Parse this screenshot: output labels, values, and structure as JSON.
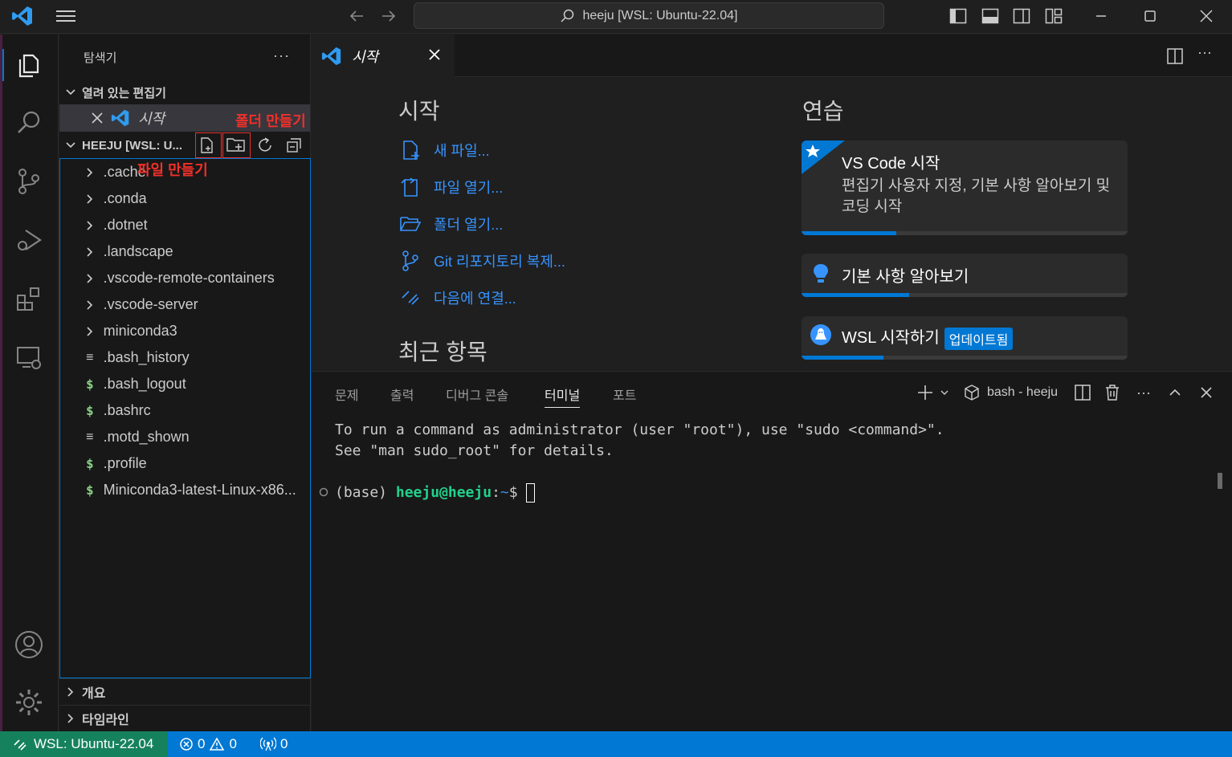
{
  "window": {
    "command_center_text": "heeju [WSL: Ubuntu-22.04]"
  },
  "sidebar": {
    "title": "탐색기",
    "open_editors_header": "열려 있는 편집기",
    "open_editors": [
      {
        "label": "시작"
      }
    ],
    "folder_header": "HEEJU [WSL: U...",
    "tree": [
      {
        "label": ".cache",
        "kind": "folder"
      },
      {
        "label": ".conda",
        "kind": "folder"
      },
      {
        "label": ".dotnet",
        "kind": "folder"
      },
      {
        "label": ".landscape",
        "kind": "folder"
      },
      {
        "label": ".vscode-remote-containers",
        "kind": "folder"
      },
      {
        "label": ".vscode-server",
        "kind": "folder"
      },
      {
        "label": "miniconda3",
        "kind": "folder"
      },
      {
        "label": ".bash_history",
        "kind": "text"
      },
      {
        "label": ".bash_logout",
        "kind": "shell"
      },
      {
        "label": ".bashrc",
        "kind": "shell"
      },
      {
        "label": ".motd_shown",
        "kind": "text"
      },
      {
        "label": ".profile",
        "kind": "shell"
      },
      {
        "label": "Miniconda3-latest-Linux-x86...",
        "kind": "shell"
      }
    ],
    "outline_label": "개요",
    "timeline_label": "타임라인"
  },
  "annotations": {
    "new_folder": "폴더 만들기",
    "new_file": "파일 만들기"
  },
  "editor": {
    "tab_label": "시작",
    "welcome": {
      "start_heading": "시작",
      "start_items": [
        {
          "label": "새 파일...",
          "icon": "new-file-icon"
        },
        {
          "label": "파일 열기...",
          "icon": "open-file-icon"
        },
        {
          "label": "폴더 열기...",
          "icon": "open-folder-icon"
        },
        {
          "label": "Git 리포지토리 복제...",
          "icon": "git-branch-icon"
        },
        {
          "label": "다음에 연결...",
          "icon": "remote-icon"
        }
      ],
      "recent_heading": "최근 항목",
      "walkthroughs_heading": "연습",
      "walkthroughs": [
        {
          "title": "VS Code 시작",
          "description": "편집기 사용자 지정, 기본 사항 알아보기 및 코딩 시작",
          "progress": 0.29
        },
        {
          "title": "기본 사항 알아보기",
          "progress": 0.33
        },
        {
          "title": "WSL 시작하기",
          "badge": "업데이트됨",
          "progress": 0.25
        }
      ]
    }
  },
  "panel": {
    "tabs": [
      "문제",
      "출력",
      "디버그 콘솔",
      "터미널",
      "포트"
    ],
    "active_tab": "터미널",
    "terminal_name": "bash - heeju",
    "terminal": {
      "line1": "To run a command as administrator (user \"root\"), use \"sudo <command>\".",
      "line2": "See \"man sudo_root\" for details.",
      "prompt_env": "(base) ",
      "prompt_user": "heeju@heeju",
      "prompt_colon": ":",
      "prompt_path": "~",
      "prompt_symbol": "$ "
    }
  },
  "statusbar": {
    "remote": "WSL: Ubuntu-22.04",
    "errors": "0",
    "warnings": "0",
    "ports": "0"
  },
  "colors": {
    "accent": "#0078d4",
    "remote_bg": "#16825d",
    "annotation": "#e8322d",
    "link": "#3794ff"
  }
}
